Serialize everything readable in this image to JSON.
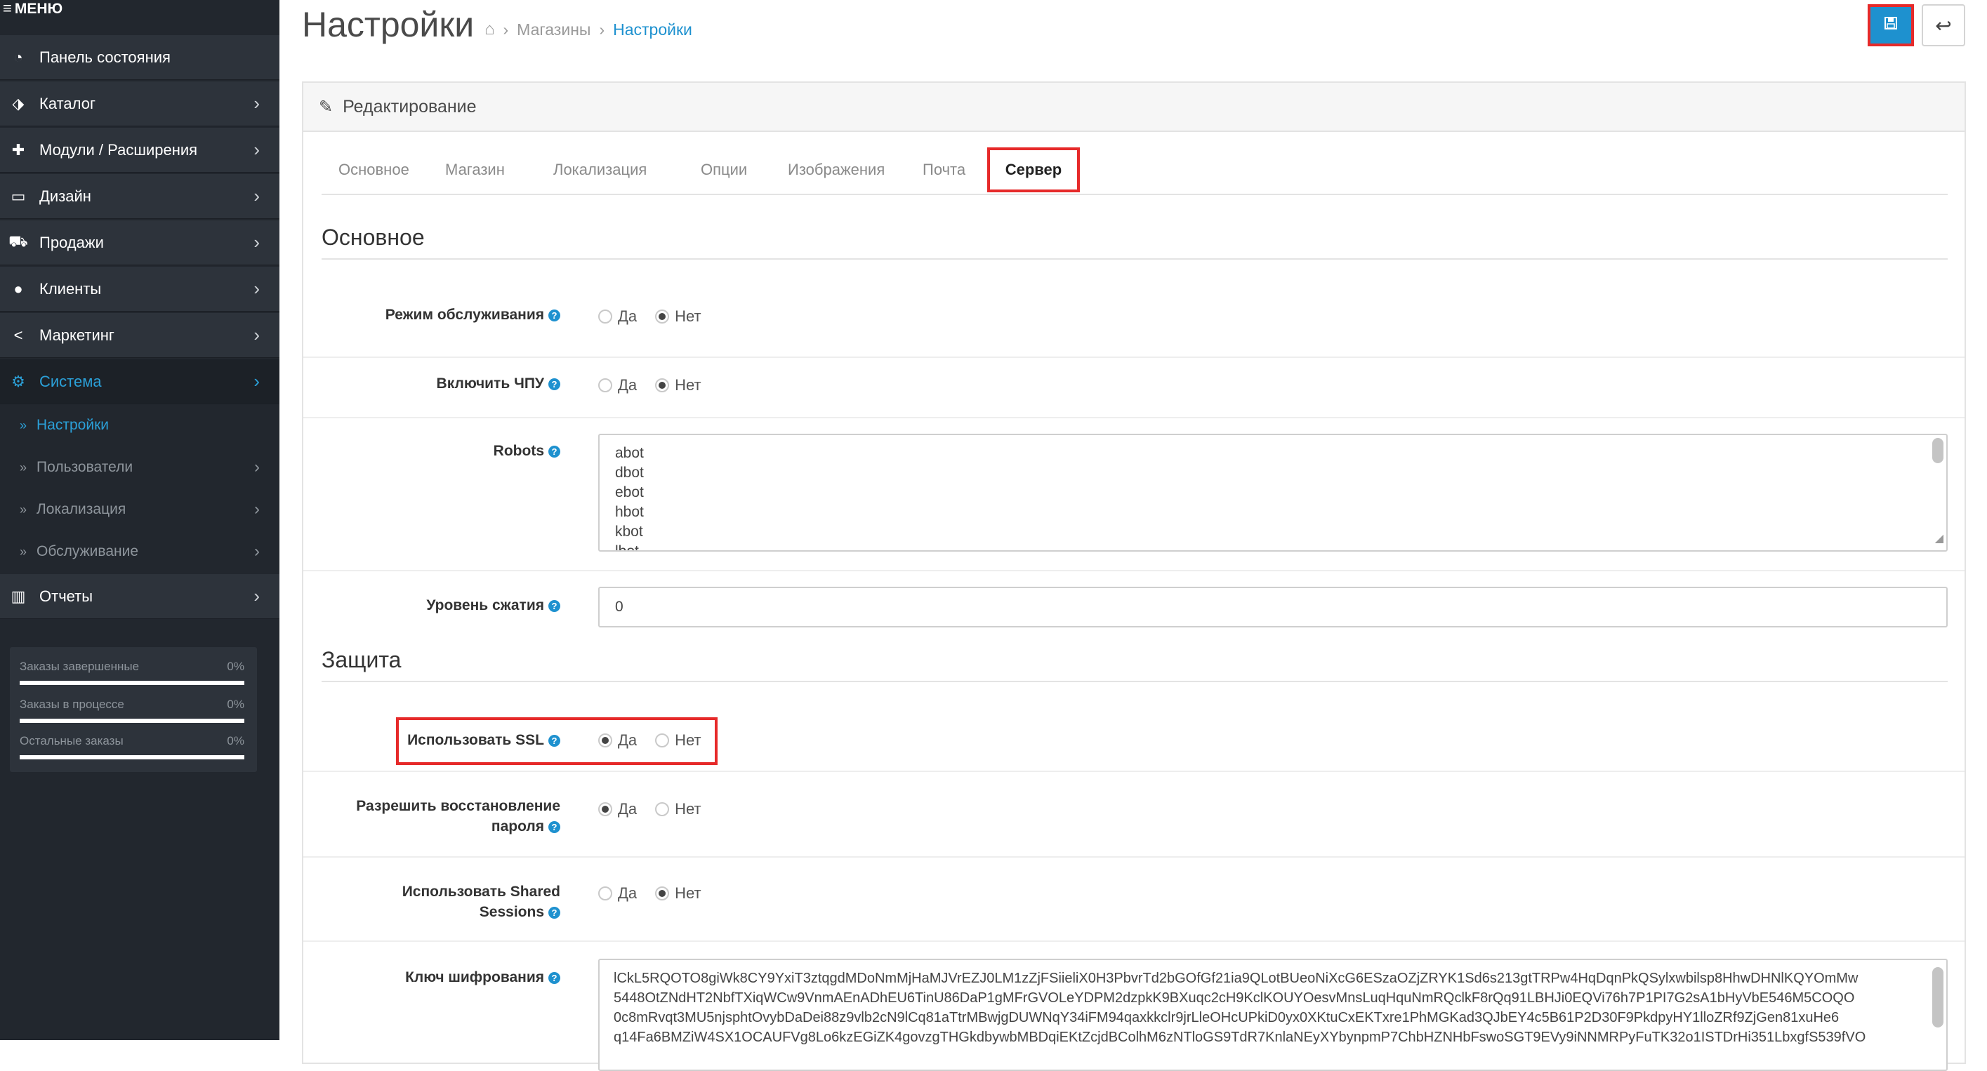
{
  "sidebar": {
    "menu_label": "МЕНЮ",
    "items": [
      {
        "label": "Панель состояния",
        "icon": "dashboard-icon"
      },
      {
        "label": "Каталог",
        "icon": "tag-icon"
      },
      {
        "label": "Модули / Расширения",
        "icon": "puzzle-icon"
      },
      {
        "label": "Дизайн",
        "icon": "monitor-icon"
      },
      {
        "label": "Продажи",
        "icon": "cart-icon"
      },
      {
        "label": "Клиенты",
        "icon": "user-icon"
      },
      {
        "label": "Маркетинг",
        "icon": "share-icon"
      },
      {
        "label": "Система",
        "icon": "gear-icon"
      }
    ],
    "subitems": [
      {
        "label": "Настройки"
      },
      {
        "label": "Пользователи"
      },
      {
        "label": "Локализация"
      },
      {
        "label": "Обслуживание"
      }
    ],
    "reports_label": "Отчеты",
    "stats": [
      {
        "label": "Заказы завершенные",
        "percent": "0%"
      },
      {
        "label": "Заказы в процессе",
        "percent": "0%"
      },
      {
        "label": "Остальные заказы",
        "percent": "0%"
      }
    ]
  },
  "header": {
    "title": "Настройки",
    "breadcrumb": [
      "Магазины",
      "Настройки"
    ]
  },
  "panel": {
    "heading": "Редактирование",
    "tabs": [
      "Основное",
      "Магазин",
      "Локализация",
      "Опции",
      "Изображения",
      "Почта",
      "Сервер"
    ],
    "active_tab": "Сервер",
    "section_main": "Основное",
    "section_security": "Защита",
    "yes": "Да",
    "no": "Нет",
    "fields": {
      "maintenance": {
        "label": "Режим обслуживания",
        "value": "Нет"
      },
      "seo_urls": {
        "label": "Включить ЧПУ",
        "value": "Нет"
      },
      "robots": {
        "label": "Robots",
        "lines": [
          "abot",
          "dbot",
          "ebot",
          "hbot",
          "kbot",
          "lbot"
        ]
      },
      "compression": {
        "label": "Уровень сжатия",
        "value": "0"
      },
      "ssl": {
        "label": "Использовать SSL",
        "value": "Да"
      },
      "password_reset": {
        "label_1": "Разрешить восстановление",
        "label_2": "пароля",
        "value": "Да"
      },
      "shared_sessions": {
        "label_1": "Использовать Shared",
        "label_2": "Sessions",
        "value": "Нет"
      },
      "encryption_key": {
        "label": "Ключ шифрования",
        "lines": [
          "lCkL5RQOTO8giWk8CY9YxiT3ztqgdMDoNmMjHaMJVrEZJ0LM1zZjFSiieliX0H3PbvrTd2bGOfGf21ia9QLotBUeoNiXcG6ESzaOZjZRYK1Sd6s213gtTRPw4HqDqnPkQSylxwbilsp8HhwDHNlKQYOmMw",
          "5448OtZNdHT2NbfTXiqWCw9VnmAEnADhEU6TinU86DaP1gMFrGVOLeYDPM2dzpkK9BXuqc2cH9KclKOUYOesvMnsLuqHquNmRQclkF8rQq91LBHJi0EQVi76h7P1PI7G2sA1bHyVbE546M5COQO",
          "0c8mRvqt3MU5njsphtOvybDaDei88z9vlb2cN9lCq81aTtrMBwjgDUWNqY34iFM94qaxkkclr9jrLleOHcUPkiD0yx0XKtuCxEKTxre1PhMGKad3QJbEY4c5B61P2D30F9PkdpyHY1lloZRf9ZjGen81xuHe6",
          "q14Fa6BMZiW4SX1OCAUFVg8Lo6kzEGiZK4govzgTHGkdbywbMBDqiEKtZcjdBColhM6zNTloGS9TdR7KnlaNEyXYbynpmP7ChbHZNHbFswoSGT9EVy9iNNMRPyFuTK32o1ISTDrHi351LbxgfS539fVO"
        ]
      }
    }
  }
}
